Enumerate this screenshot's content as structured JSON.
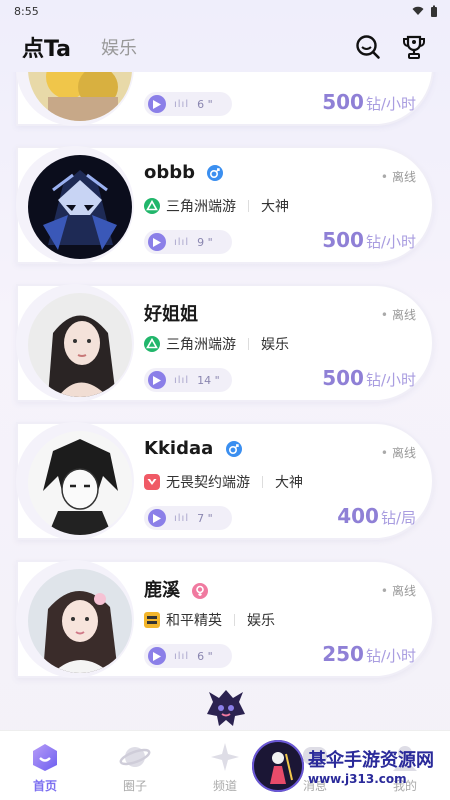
{
  "status_bar": {
    "time": "8:55"
  },
  "header": {
    "tab_main": "点Ta",
    "tab_other": "娱乐"
  },
  "cards": [
    {
      "name": "",
      "status": "",
      "game": "",
      "role": "",
      "voice": "6 \"",
      "price": "500",
      "unit": "钻/小时"
    },
    {
      "name": "obbb",
      "status": "离线",
      "game": "三角洲端游",
      "role": "大神",
      "voice": "9 \"",
      "price": "500",
      "unit": "钻/小时"
    },
    {
      "name": "好姐姐",
      "status": "离线",
      "game": "三角洲端游",
      "role": "娱乐",
      "voice": "14 \"",
      "price": "500",
      "unit": "钻/小时"
    },
    {
      "name": "Kkidaa",
      "status": "离线",
      "game": "无畏契约端游",
      "role": "大神",
      "voice": "7 \"",
      "price": "400",
      "unit": "钻/局"
    },
    {
      "name": "鹿溪",
      "status": "离线",
      "game": "和平精英",
      "role": "娱乐",
      "voice": "6 \"",
      "price": "250",
      "unit": "钻/小时"
    }
  ],
  "bottom_nav": [
    {
      "label": "首页",
      "active": true
    },
    {
      "label": "圈子"
    },
    {
      "label": "频道"
    },
    {
      "label": "消息"
    },
    {
      "label": "我的"
    }
  ],
  "watermark": {
    "title": "基伞手游资源网",
    "url": "www.j313.com"
  },
  "colors": {
    "accent": "#8b7fe8",
    "price": "#8f80d6"
  }
}
